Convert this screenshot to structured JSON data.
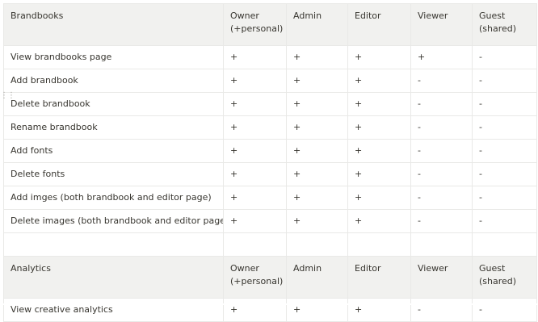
{
  "tables": [
    {
      "headers": [
        "Brandbooks",
        "Owner\n(+personal)",
        "Admin",
        "Editor",
        "Viewer",
        "Guest\n(shared)"
      ],
      "rows": [
        [
          "View brandbooks page",
          "+",
          "+",
          "+",
          "+",
          "-"
        ],
        [
          "Add brandbook",
          "+",
          "+",
          "+",
          "-",
          "-"
        ],
        [
          "Delete brandbook",
          "+",
          "+",
          "+",
          "-",
          "-"
        ],
        [
          "Rename brandbook",
          "+",
          "+",
          "+",
          "-",
          "-"
        ],
        [
          "Add fonts",
          "+",
          "+",
          "+",
          "-",
          "-"
        ],
        [
          "Delete fonts",
          "+",
          "+",
          "+",
          "-",
          "-"
        ],
        [
          "Add imges (both brandbook and editor page)",
          "+",
          "+",
          "+",
          "-",
          "-"
        ],
        [
          "Delete images (both brandbook and editor page)",
          "+",
          "+",
          "+",
          "-",
          "-"
        ]
      ]
    },
    {
      "headers": [
        "Analytics",
        "Owner\n(+personal)",
        "Admin",
        "Editor",
        "Viewer",
        "Guest\n(shared)"
      ],
      "rows": [
        [
          "View creative analytics",
          "+",
          "+",
          "+",
          "-",
          "-"
        ]
      ]
    }
  ],
  "drag_handle_icon": "drag-handle-icon",
  "colors": {
    "header_bg": "#f1f1ef",
    "border": "#e9e9e7",
    "text": "#37352f"
  }
}
